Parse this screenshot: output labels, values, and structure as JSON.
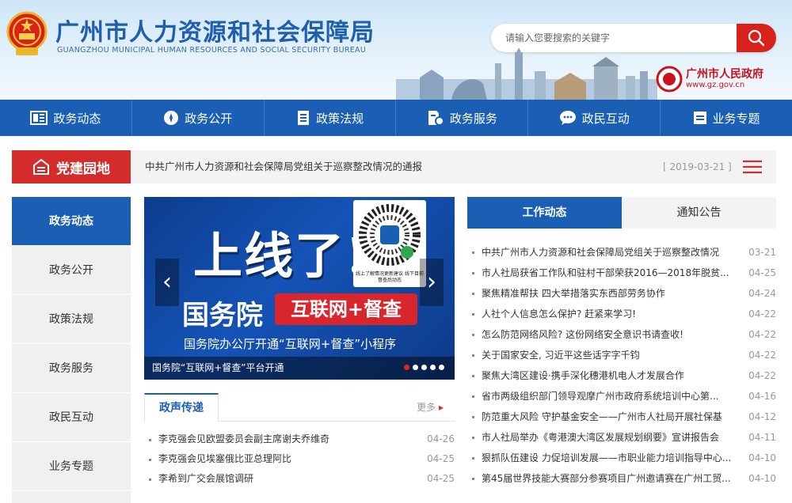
{
  "header": {
    "title": "广州市人力资源和社会保障局",
    "subtitle": "GUANGZHOU MUNICIPAL HUMAN RESOURCES AND SOCIAL SECURITY BUREAU",
    "search_placeholder": "请输入您要搜索的关键字",
    "gov_logo": {
      "name": "广州市人民政府",
      "url": "www.gz.gov.cn"
    }
  },
  "nav": [
    {
      "label": "政务动态",
      "icon": "news-icon"
    },
    {
      "label": "政务公开",
      "icon": "compass-icon"
    },
    {
      "label": "政策法规",
      "icon": "document-icon"
    },
    {
      "label": "政务服务",
      "icon": "service-icon"
    },
    {
      "label": "政民互动",
      "icon": "chat-icon"
    },
    {
      "label": "业务专题",
      "icon": "topic-icon"
    }
  ],
  "party": {
    "badge": "党建园地",
    "headline": "中共广州市人力资源和社会保障局党组关于巡察整改情况的通报",
    "date": "[ 2019-03-21 ]"
  },
  "sidebar": [
    {
      "label": "政务动态",
      "active": true
    },
    {
      "label": "政务公开"
    },
    {
      "label": "政策法规"
    },
    {
      "label": "政务服务"
    },
    {
      "label": "政民互动"
    },
    {
      "label": "业务专题"
    }
  ],
  "banner": {
    "headline": "上线了!",
    "org": "国务院",
    "tag": "互联网+督查",
    "subline": "国务院办公厅开通“互联网+督查”小程序",
    "caption": "国务院“互联网+督查”平台开通",
    "qr_caption": "线上了解情况更新建议 线下目前督查后动态",
    "active_slide": 1,
    "slide_count": 5
  },
  "voice": {
    "tab": "政声传递",
    "more": "更多",
    "items": [
      {
        "title": "李克强会见欧盟委员会副主席谢夫乔维奇",
        "date": "04-26"
      },
      {
        "title": "李克强会见埃塞俄比亚总理阿比",
        "date": "04-25"
      },
      {
        "title": "李希到广交会展馆调研",
        "date": "04-25"
      }
    ]
  },
  "work": {
    "tab_active": "工作动态",
    "tab_other": "通知公告",
    "items": [
      {
        "title": "中共广州市人力资源和社会保障局党组关于巡察整改情况",
        "date": "03-21"
      },
      {
        "title": "市人社局获省工作队和驻村干部荣获2016—2018年脱贫...",
        "date": "04-25"
      },
      {
        "title": "聚焦精准帮扶 四大举措落实东西部劳务协作",
        "date": "04-24"
      },
      {
        "title": "人社个人信息怎么保护? 赶紧来学习!",
        "date": "04-22"
      },
      {
        "title": "怎么防范网络风险? 这份网络安全意识书请查收!",
        "date": "04-22"
      },
      {
        "title": "关于国家安全, 习近平这些话字字千钧",
        "date": "04-22"
      },
      {
        "title": "聚焦大湾区建设·携手深化穗港机电人才发展合作",
        "date": "04-22"
      },
      {
        "title": "省市两级组织部门领导观摩广州市政府系统培训中心第...",
        "date": "04-16"
      },
      {
        "title": "防范重大风险 守护基金安全——广州市人社局开展社保基",
        "date": "04-12"
      },
      {
        "title": "市人社局举办《粤港澳大湾区发展规划纲要》宣讲报告会",
        "date": "04-11"
      },
      {
        "title": "狠抓队伍建设 力促培训发展——市职业能力培训指导中心...",
        "date": "04-10"
      },
      {
        "title": "第45届世界技能大赛部分参赛项目广州邀请赛在广州工贸...",
        "date": "04-10"
      }
    ]
  },
  "colors": {
    "primary": "#1a5fb4",
    "red": "#d32c2a",
    "search_red": "#d6221b"
  }
}
